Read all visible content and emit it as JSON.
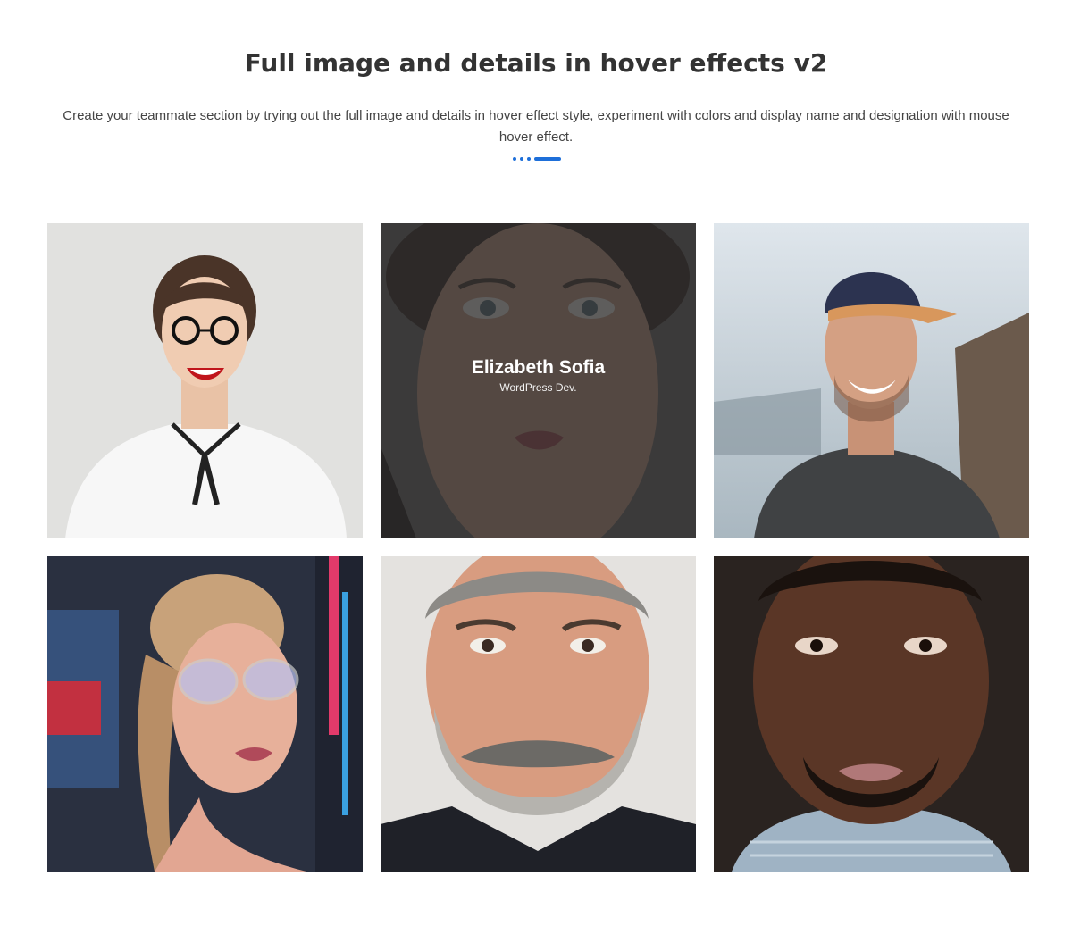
{
  "section": {
    "title": "Full image and details in hover effects v2",
    "description": "Create your teammate section by trying out the full image and details in hover effect style, experiment with colors and display name and designation with mouse hover effect.",
    "accent_color": "#1e6fd9"
  },
  "team": [
    {
      "photo": "woman-with-glasses-photo"
    },
    {
      "photo": "freckled-woman-photo",
      "name": "Elizabeth Sofia",
      "role": "WordPress Dev.",
      "hovered": true
    },
    {
      "photo": "man-with-cap-photo"
    },
    {
      "photo": "woman-neon-lights-photo"
    },
    {
      "photo": "bearded-man-photo"
    },
    {
      "photo": "man-portrait-photo"
    }
  ]
}
